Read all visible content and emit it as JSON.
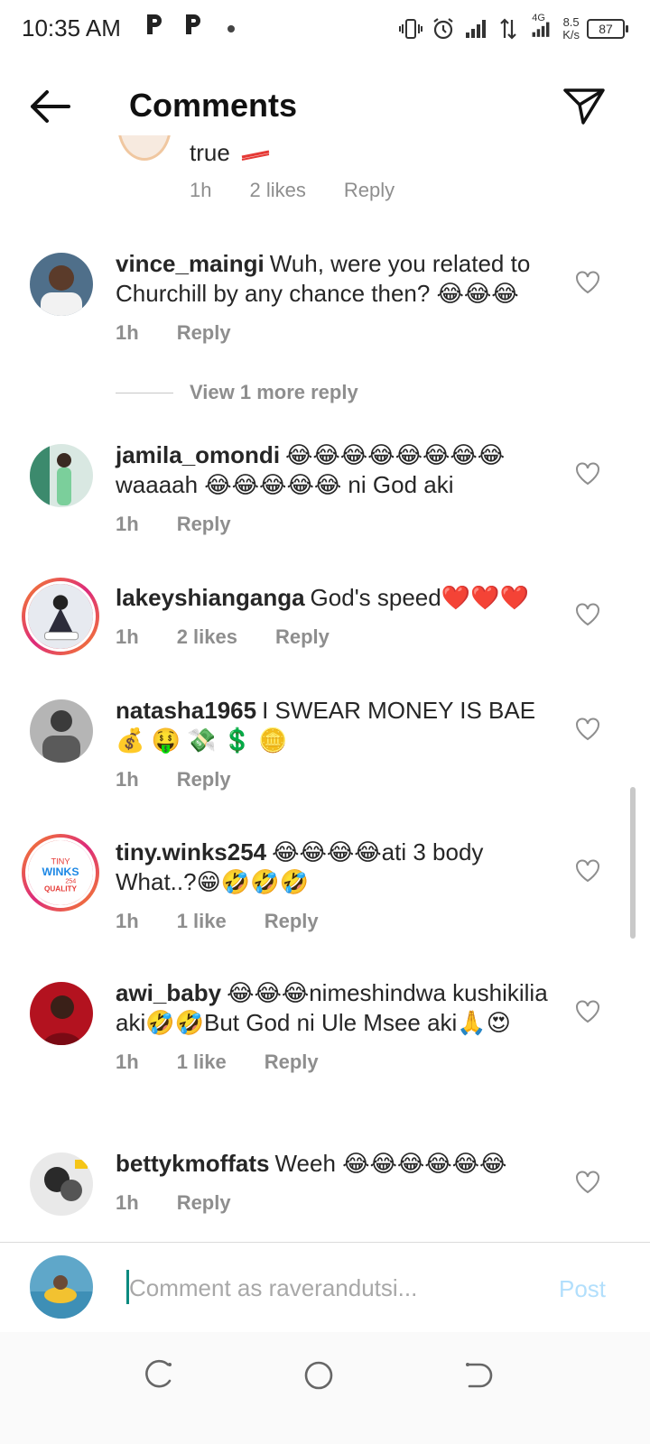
{
  "status_bar": {
    "time": "10:35 AM",
    "network": "4G",
    "speed_value": "8.5",
    "speed_unit": "K/s",
    "battery": "87"
  },
  "header": {
    "title": "Comments",
    "back_icon": "arrow-left-icon",
    "share_icon": "paper-plane-icon"
  },
  "partial_comment": {
    "text": "true",
    "time": "1h",
    "likes": "2 likes",
    "reply": "Reply"
  },
  "view_more": "View 1 more reply",
  "comments": [
    {
      "username": "vince_maingi",
      "text": "Wuh, were you related to Churchill by any chance then? 😂😂😂",
      "time": "1h",
      "likes": "",
      "reply": "Reply"
    },
    {
      "username": "jamila_omondi",
      "text": "😂😂😂😂😂😂😂😂 waaaah 😂😂😂😂😂 ni  God aki",
      "time": "1h",
      "likes": "",
      "reply": "Reply"
    },
    {
      "username": "lakeyshianganga",
      "text": "God's speed❤️❤️❤️",
      "time": "1h",
      "likes": "2 likes",
      "reply": "Reply"
    },
    {
      "username": "natasha1965",
      "text": "I SWEAR MONEY IS BAE 💰 🤑 💸 💲 🪙",
      "time": "1h",
      "likes": "",
      "reply": "Reply"
    },
    {
      "username": "tiny.winks254",
      "text": "😂😂😂😂ati 3 body What..?😁🤣🤣🤣",
      "time": "1h",
      "likes": "1 like",
      "reply": "Reply"
    },
    {
      "username": "awi_baby",
      "text": "😂😂😂nimeshindwa kushikilia aki🤣🤣But God ni Ule Msee aki🙏😍",
      "time": "1h",
      "likes": "1 like",
      "reply": "Reply"
    },
    {
      "username": "bettykmoffats",
      "text": "Weeh 😂😂😂😂😂😂",
      "time": "1h",
      "likes": "",
      "reply": "Reply"
    }
  ],
  "tiny_winks_logo": {
    "line1": "TINY",
    "line2": "WINKS",
    "line3": "254",
    "line4": "QUALITY"
  },
  "composer": {
    "placeholder": "Comment as raverandutsi...",
    "post_label": "Post"
  },
  "colors": {
    "meta_gray": "#8e8e8e",
    "post_disabled": "#b2dffc",
    "story_ring": "#dd2a7b"
  }
}
